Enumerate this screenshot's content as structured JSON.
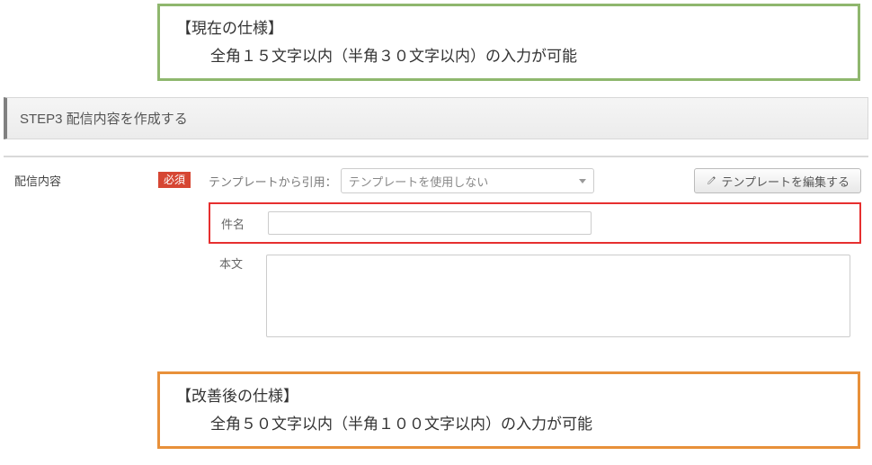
{
  "callout_current": {
    "title": "【現在の仕様】",
    "desc": "全角１５文字以内（半角３０文字以内）の入力が可能"
  },
  "step_header": "STEP3 配信内容を作成する",
  "form": {
    "section_label": "配信内容",
    "required_badge": "必須",
    "template_label": "テンプレートから引用：",
    "template_placeholder": "テンプレートを使用しない",
    "edit_button": "テンプレートを編集する",
    "subject_label": "件名",
    "subject_value": "",
    "body_label": "本文",
    "body_value": ""
  },
  "callout_improved": {
    "title": "【改善後の仕様】",
    "desc": "全角５０文字以内（半角１００文字以内）の入力が可能"
  }
}
